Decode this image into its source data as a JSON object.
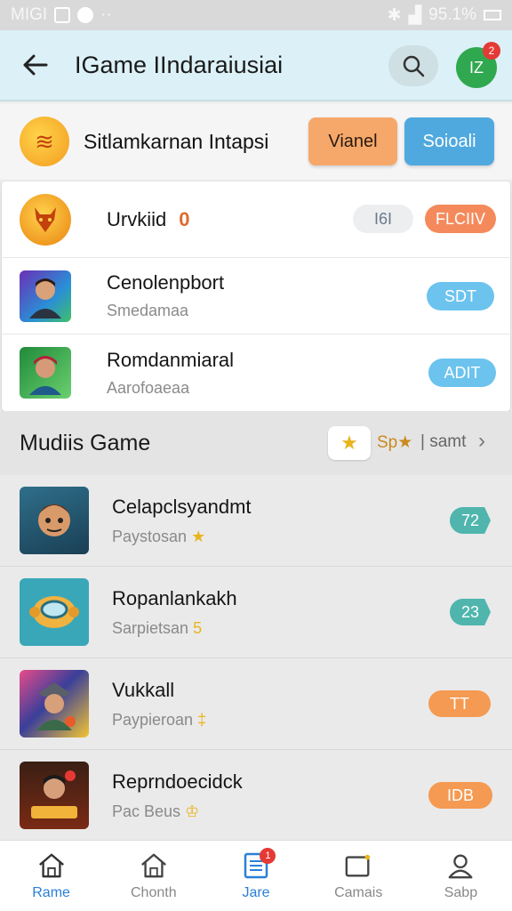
{
  "status_bar": {
    "left_text": "MIGI",
    "right_text": "95.1%"
  },
  "header": {
    "title": "IGame IIndaraiusiai",
    "avatar_text": "IZ",
    "avatar_badge": "2"
  },
  "feature": {
    "title": "Sitlamkarnan Intapsi",
    "btn_left": "Vianel",
    "btn_right": "Soioali"
  },
  "top_list": [
    {
      "title": "Urvkiid",
      "title_num": "0",
      "subtitle": "",
      "pill_grey": "I6I",
      "pill": "FLCIIV"
    },
    {
      "title": "Cenolenpbort",
      "subtitle": "Smedamaa",
      "pill": "SDT"
    },
    {
      "title": "Romdanmiaral",
      "subtitle": "Aarofoaeaa",
      "pill": "ADIT"
    }
  ],
  "section2": {
    "title": "Mudiis Game",
    "sort_label": "Sp★",
    "divider_label": "| samt"
  },
  "game_list": [
    {
      "title": "Celapclsyandmt",
      "subtitle": "Paystosan",
      "mark": "★",
      "tag": "72"
    },
    {
      "title": "Ropanlankakh",
      "subtitle": "Sarpietsan",
      "mark": "5",
      "tag": "23"
    },
    {
      "title": "Vukkall",
      "subtitle": "Paypieroan",
      "mark": "‡",
      "tag": "TT"
    },
    {
      "title": "Reprndoecidck",
      "subtitle": "Pac Beus",
      "mark": "♔",
      "tag": "IDB"
    }
  ],
  "nav": [
    {
      "label": "Rame",
      "active": true
    },
    {
      "label": "Chonth"
    },
    {
      "label": "Jare",
      "badge": "1"
    },
    {
      "label": "Camais"
    },
    {
      "label": "Sabp"
    }
  ],
  "colors": {
    "accent": "#2a7fd6",
    "appbar": "#dcf0f7",
    "orange": "#f6a86a",
    "blue": "#4fa9de",
    "teal": "#4fb5ad"
  }
}
